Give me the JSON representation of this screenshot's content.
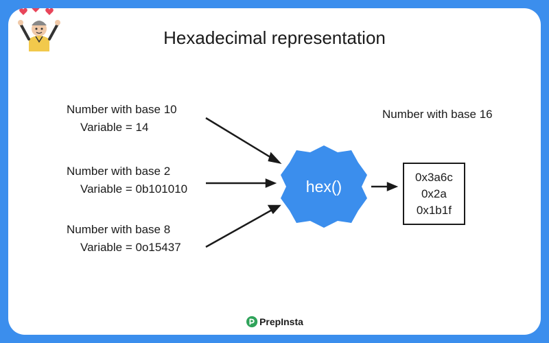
{
  "title": "Hexadecimal representation",
  "inputs": [
    {
      "label": "Number with base 10",
      "value": "Variable = 14"
    },
    {
      "label": "Number with base 2",
      "value": "Variable = 0b101010"
    },
    {
      "label": "Number with base 8",
      "value": "Variable = 0o15437"
    }
  ],
  "function_name": "hex()",
  "output_label": "Number with base 16",
  "outputs": [
    "0x3a6c",
    "0x2a",
    "0x1b1f"
  ],
  "brand": "PrepInsta",
  "colors": {
    "frame": "#3b8eed",
    "badge": "#3b8eed",
    "brand_accent": "#2fa35a"
  }
}
